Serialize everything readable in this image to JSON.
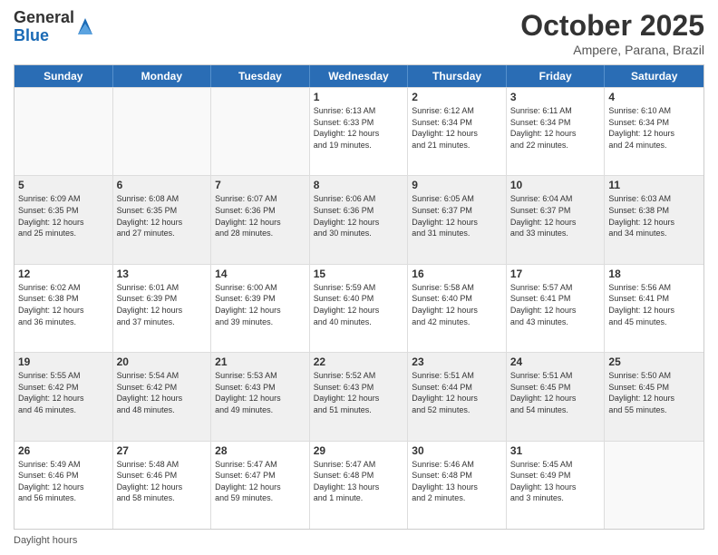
{
  "header": {
    "logo_general": "General",
    "logo_blue": "Blue",
    "month_title": "October 2025",
    "location": "Ampere, Parana, Brazil"
  },
  "days_of_week": [
    "Sunday",
    "Monday",
    "Tuesday",
    "Wednesday",
    "Thursday",
    "Friday",
    "Saturday"
  ],
  "footer_text": "Daylight hours",
  "weeks": [
    [
      {
        "day": "",
        "info": "",
        "empty": true
      },
      {
        "day": "",
        "info": "",
        "empty": true
      },
      {
        "day": "",
        "info": "",
        "empty": true
      },
      {
        "day": "1",
        "info": "Sunrise: 6:13 AM\nSunset: 6:33 PM\nDaylight: 12 hours\nand 19 minutes."
      },
      {
        "day": "2",
        "info": "Sunrise: 6:12 AM\nSunset: 6:34 PM\nDaylight: 12 hours\nand 21 minutes."
      },
      {
        "day": "3",
        "info": "Sunrise: 6:11 AM\nSunset: 6:34 PM\nDaylight: 12 hours\nand 22 minutes."
      },
      {
        "day": "4",
        "info": "Sunrise: 6:10 AM\nSunset: 6:34 PM\nDaylight: 12 hours\nand 24 minutes."
      }
    ],
    [
      {
        "day": "5",
        "info": "Sunrise: 6:09 AM\nSunset: 6:35 PM\nDaylight: 12 hours\nand 25 minutes.",
        "shaded": true
      },
      {
        "day": "6",
        "info": "Sunrise: 6:08 AM\nSunset: 6:35 PM\nDaylight: 12 hours\nand 27 minutes.",
        "shaded": true
      },
      {
        "day": "7",
        "info": "Sunrise: 6:07 AM\nSunset: 6:36 PM\nDaylight: 12 hours\nand 28 minutes.",
        "shaded": true
      },
      {
        "day": "8",
        "info": "Sunrise: 6:06 AM\nSunset: 6:36 PM\nDaylight: 12 hours\nand 30 minutes.",
        "shaded": true
      },
      {
        "day": "9",
        "info": "Sunrise: 6:05 AM\nSunset: 6:37 PM\nDaylight: 12 hours\nand 31 minutes.",
        "shaded": true
      },
      {
        "day": "10",
        "info": "Sunrise: 6:04 AM\nSunset: 6:37 PM\nDaylight: 12 hours\nand 33 minutes.",
        "shaded": true
      },
      {
        "day": "11",
        "info": "Sunrise: 6:03 AM\nSunset: 6:38 PM\nDaylight: 12 hours\nand 34 minutes.",
        "shaded": true
      }
    ],
    [
      {
        "day": "12",
        "info": "Sunrise: 6:02 AM\nSunset: 6:38 PM\nDaylight: 12 hours\nand 36 minutes."
      },
      {
        "day": "13",
        "info": "Sunrise: 6:01 AM\nSunset: 6:39 PM\nDaylight: 12 hours\nand 37 minutes."
      },
      {
        "day": "14",
        "info": "Sunrise: 6:00 AM\nSunset: 6:39 PM\nDaylight: 12 hours\nand 39 minutes."
      },
      {
        "day": "15",
        "info": "Sunrise: 5:59 AM\nSunset: 6:40 PM\nDaylight: 12 hours\nand 40 minutes."
      },
      {
        "day": "16",
        "info": "Sunrise: 5:58 AM\nSunset: 6:40 PM\nDaylight: 12 hours\nand 42 minutes."
      },
      {
        "day": "17",
        "info": "Sunrise: 5:57 AM\nSunset: 6:41 PM\nDaylight: 12 hours\nand 43 minutes."
      },
      {
        "day": "18",
        "info": "Sunrise: 5:56 AM\nSunset: 6:41 PM\nDaylight: 12 hours\nand 45 minutes."
      }
    ],
    [
      {
        "day": "19",
        "info": "Sunrise: 5:55 AM\nSunset: 6:42 PM\nDaylight: 12 hours\nand 46 minutes.",
        "shaded": true
      },
      {
        "day": "20",
        "info": "Sunrise: 5:54 AM\nSunset: 6:42 PM\nDaylight: 12 hours\nand 48 minutes.",
        "shaded": true
      },
      {
        "day": "21",
        "info": "Sunrise: 5:53 AM\nSunset: 6:43 PM\nDaylight: 12 hours\nand 49 minutes.",
        "shaded": true
      },
      {
        "day": "22",
        "info": "Sunrise: 5:52 AM\nSunset: 6:43 PM\nDaylight: 12 hours\nand 51 minutes.",
        "shaded": true
      },
      {
        "day": "23",
        "info": "Sunrise: 5:51 AM\nSunset: 6:44 PM\nDaylight: 12 hours\nand 52 minutes.",
        "shaded": true
      },
      {
        "day": "24",
        "info": "Sunrise: 5:51 AM\nSunset: 6:45 PM\nDaylight: 12 hours\nand 54 minutes.",
        "shaded": true
      },
      {
        "day": "25",
        "info": "Sunrise: 5:50 AM\nSunset: 6:45 PM\nDaylight: 12 hours\nand 55 minutes.",
        "shaded": true
      }
    ],
    [
      {
        "day": "26",
        "info": "Sunrise: 5:49 AM\nSunset: 6:46 PM\nDaylight: 12 hours\nand 56 minutes."
      },
      {
        "day": "27",
        "info": "Sunrise: 5:48 AM\nSunset: 6:46 PM\nDaylight: 12 hours\nand 58 minutes."
      },
      {
        "day": "28",
        "info": "Sunrise: 5:47 AM\nSunset: 6:47 PM\nDaylight: 12 hours\nand 59 minutes."
      },
      {
        "day": "29",
        "info": "Sunrise: 5:47 AM\nSunset: 6:48 PM\nDaylight: 13 hours\nand 1 minute."
      },
      {
        "day": "30",
        "info": "Sunrise: 5:46 AM\nSunset: 6:48 PM\nDaylight: 13 hours\nand 2 minutes."
      },
      {
        "day": "31",
        "info": "Sunrise: 5:45 AM\nSunset: 6:49 PM\nDaylight: 13 hours\nand 3 minutes."
      },
      {
        "day": "",
        "info": "",
        "empty": true
      }
    ]
  ]
}
